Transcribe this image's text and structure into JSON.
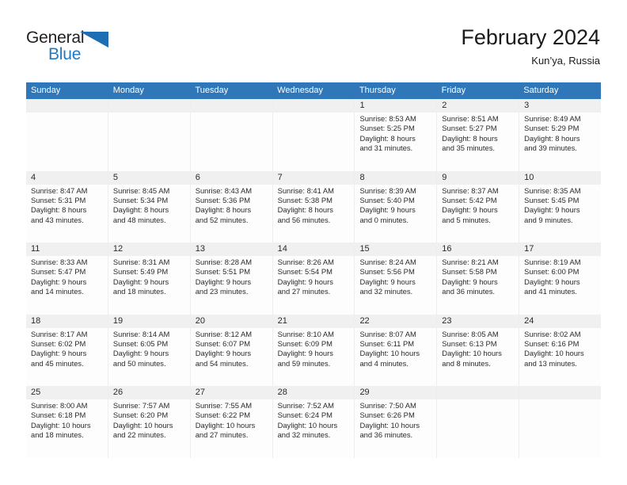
{
  "brand": {
    "name_top": "General",
    "name_bottom": "Blue",
    "triangle_color": "#1f6eb4",
    "blue_text_color": "#1f7ac4"
  },
  "header": {
    "title": "February 2024",
    "location": "Kun’ya, Russia"
  },
  "theme": {
    "header_blue": "#2f77b8",
    "daynum_strip_grey": "#f0f0f0",
    "cell_background": "#fdfdfd",
    "text_color": "#2a2a2a"
  },
  "weekdays": [
    "Sunday",
    "Monday",
    "Tuesday",
    "Wednesday",
    "Thursday",
    "Friday",
    "Saturday"
  ],
  "calendar": {
    "month": "February",
    "year": "2024",
    "weeks": [
      [
        {
          "day": "",
          "lines": []
        },
        {
          "day": "",
          "lines": []
        },
        {
          "day": "",
          "lines": []
        },
        {
          "day": "",
          "lines": []
        },
        {
          "day": "1",
          "lines": [
            "Sunrise: 8:53 AM",
            "Sunset: 5:25 PM",
            "Daylight: 8 hours",
            "and 31 minutes."
          ]
        },
        {
          "day": "2",
          "lines": [
            "Sunrise: 8:51 AM",
            "Sunset: 5:27 PM",
            "Daylight: 8 hours",
            "and 35 minutes."
          ]
        },
        {
          "day": "3",
          "lines": [
            "Sunrise: 8:49 AM",
            "Sunset: 5:29 PM",
            "Daylight: 8 hours",
            "and 39 minutes."
          ]
        }
      ],
      [
        {
          "day": "4",
          "lines": [
            "Sunrise: 8:47 AM",
            "Sunset: 5:31 PM",
            "Daylight: 8 hours",
            "and 43 minutes."
          ]
        },
        {
          "day": "5",
          "lines": [
            "Sunrise: 8:45 AM",
            "Sunset: 5:34 PM",
            "Daylight: 8 hours",
            "and 48 minutes."
          ]
        },
        {
          "day": "6",
          "lines": [
            "Sunrise: 8:43 AM",
            "Sunset: 5:36 PM",
            "Daylight: 8 hours",
            "and 52 minutes."
          ]
        },
        {
          "day": "7",
          "lines": [
            "Sunrise: 8:41 AM",
            "Sunset: 5:38 PM",
            "Daylight: 8 hours",
            "and 56 minutes."
          ]
        },
        {
          "day": "8",
          "lines": [
            "Sunrise: 8:39 AM",
            "Sunset: 5:40 PM",
            "Daylight: 9 hours",
            "and 0 minutes."
          ]
        },
        {
          "day": "9",
          "lines": [
            "Sunrise: 8:37 AM",
            "Sunset: 5:42 PM",
            "Daylight: 9 hours",
            "and 5 minutes."
          ]
        },
        {
          "day": "10",
          "lines": [
            "Sunrise: 8:35 AM",
            "Sunset: 5:45 PM",
            "Daylight: 9 hours",
            "and 9 minutes."
          ]
        }
      ],
      [
        {
          "day": "11",
          "lines": [
            "Sunrise: 8:33 AM",
            "Sunset: 5:47 PM",
            "Daylight: 9 hours",
            "and 14 minutes."
          ]
        },
        {
          "day": "12",
          "lines": [
            "Sunrise: 8:31 AM",
            "Sunset: 5:49 PM",
            "Daylight: 9 hours",
            "and 18 minutes."
          ]
        },
        {
          "day": "13",
          "lines": [
            "Sunrise: 8:28 AM",
            "Sunset: 5:51 PM",
            "Daylight: 9 hours",
            "and 23 minutes."
          ]
        },
        {
          "day": "14",
          "lines": [
            "Sunrise: 8:26 AM",
            "Sunset: 5:54 PM",
            "Daylight: 9 hours",
            "and 27 minutes."
          ]
        },
        {
          "day": "15",
          "lines": [
            "Sunrise: 8:24 AM",
            "Sunset: 5:56 PM",
            "Daylight: 9 hours",
            "and 32 minutes."
          ]
        },
        {
          "day": "16",
          "lines": [
            "Sunrise: 8:21 AM",
            "Sunset: 5:58 PM",
            "Daylight: 9 hours",
            "and 36 minutes."
          ]
        },
        {
          "day": "17",
          "lines": [
            "Sunrise: 8:19 AM",
            "Sunset: 6:00 PM",
            "Daylight: 9 hours",
            "and 41 minutes."
          ]
        }
      ],
      [
        {
          "day": "18",
          "lines": [
            "Sunrise: 8:17 AM",
            "Sunset: 6:02 PM",
            "Daylight: 9 hours",
            "and 45 minutes."
          ]
        },
        {
          "day": "19",
          "lines": [
            "Sunrise: 8:14 AM",
            "Sunset: 6:05 PM",
            "Daylight: 9 hours",
            "and 50 minutes."
          ]
        },
        {
          "day": "20",
          "lines": [
            "Sunrise: 8:12 AM",
            "Sunset: 6:07 PM",
            "Daylight: 9 hours",
            "and 54 minutes."
          ]
        },
        {
          "day": "21",
          "lines": [
            "Sunrise: 8:10 AM",
            "Sunset: 6:09 PM",
            "Daylight: 9 hours",
            "and 59 minutes."
          ]
        },
        {
          "day": "22",
          "lines": [
            "Sunrise: 8:07 AM",
            "Sunset: 6:11 PM",
            "Daylight: 10 hours",
            "and 4 minutes."
          ]
        },
        {
          "day": "23",
          "lines": [
            "Sunrise: 8:05 AM",
            "Sunset: 6:13 PM",
            "Daylight: 10 hours",
            "and 8 minutes."
          ]
        },
        {
          "day": "24",
          "lines": [
            "Sunrise: 8:02 AM",
            "Sunset: 6:16 PM",
            "Daylight: 10 hours",
            "and 13 minutes."
          ]
        }
      ],
      [
        {
          "day": "25",
          "lines": [
            "Sunrise: 8:00 AM",
            "Sunset: 6:18 PM",
            "Daylight: 10 hours",
            "and 18 minutes."
          ]
        },
        {
          "day": "26",
          "lines": [
            "Sunrise: 7:57 AM",
            "Sunset: 6:20 PM",
            "Daylight: 10 hours",
            "and 22 minutes."
          ]
        },
        {
          "day": "27",
          "lines": [
            "Sunrise: 7:55 AM",
            "Sunset: 6:22 PM",
            "Daylight: 10 hours",
            "and 27 minutes."
          ]
        },
        {
          "day": "28",
          "lines": [
            "Sunrise: 7:52 AM",
            "Sunset: 6:24 PM",
            "Daylight: 10 hours",
            "and 32 minutes."
          ]
        },
        {
          "day": "29",
          "lines": [
            "Sunrise: 7:50 AM",
            "Sunset: 6:26 PM",
            "Daylight: 10 hours",
            "and 36 minutes."
          ]
        },
        {
          "day": "",
          "lines": []
        },
        {
          "day": "",
          "lines": []
        }
      ]
    ]
  }
}
